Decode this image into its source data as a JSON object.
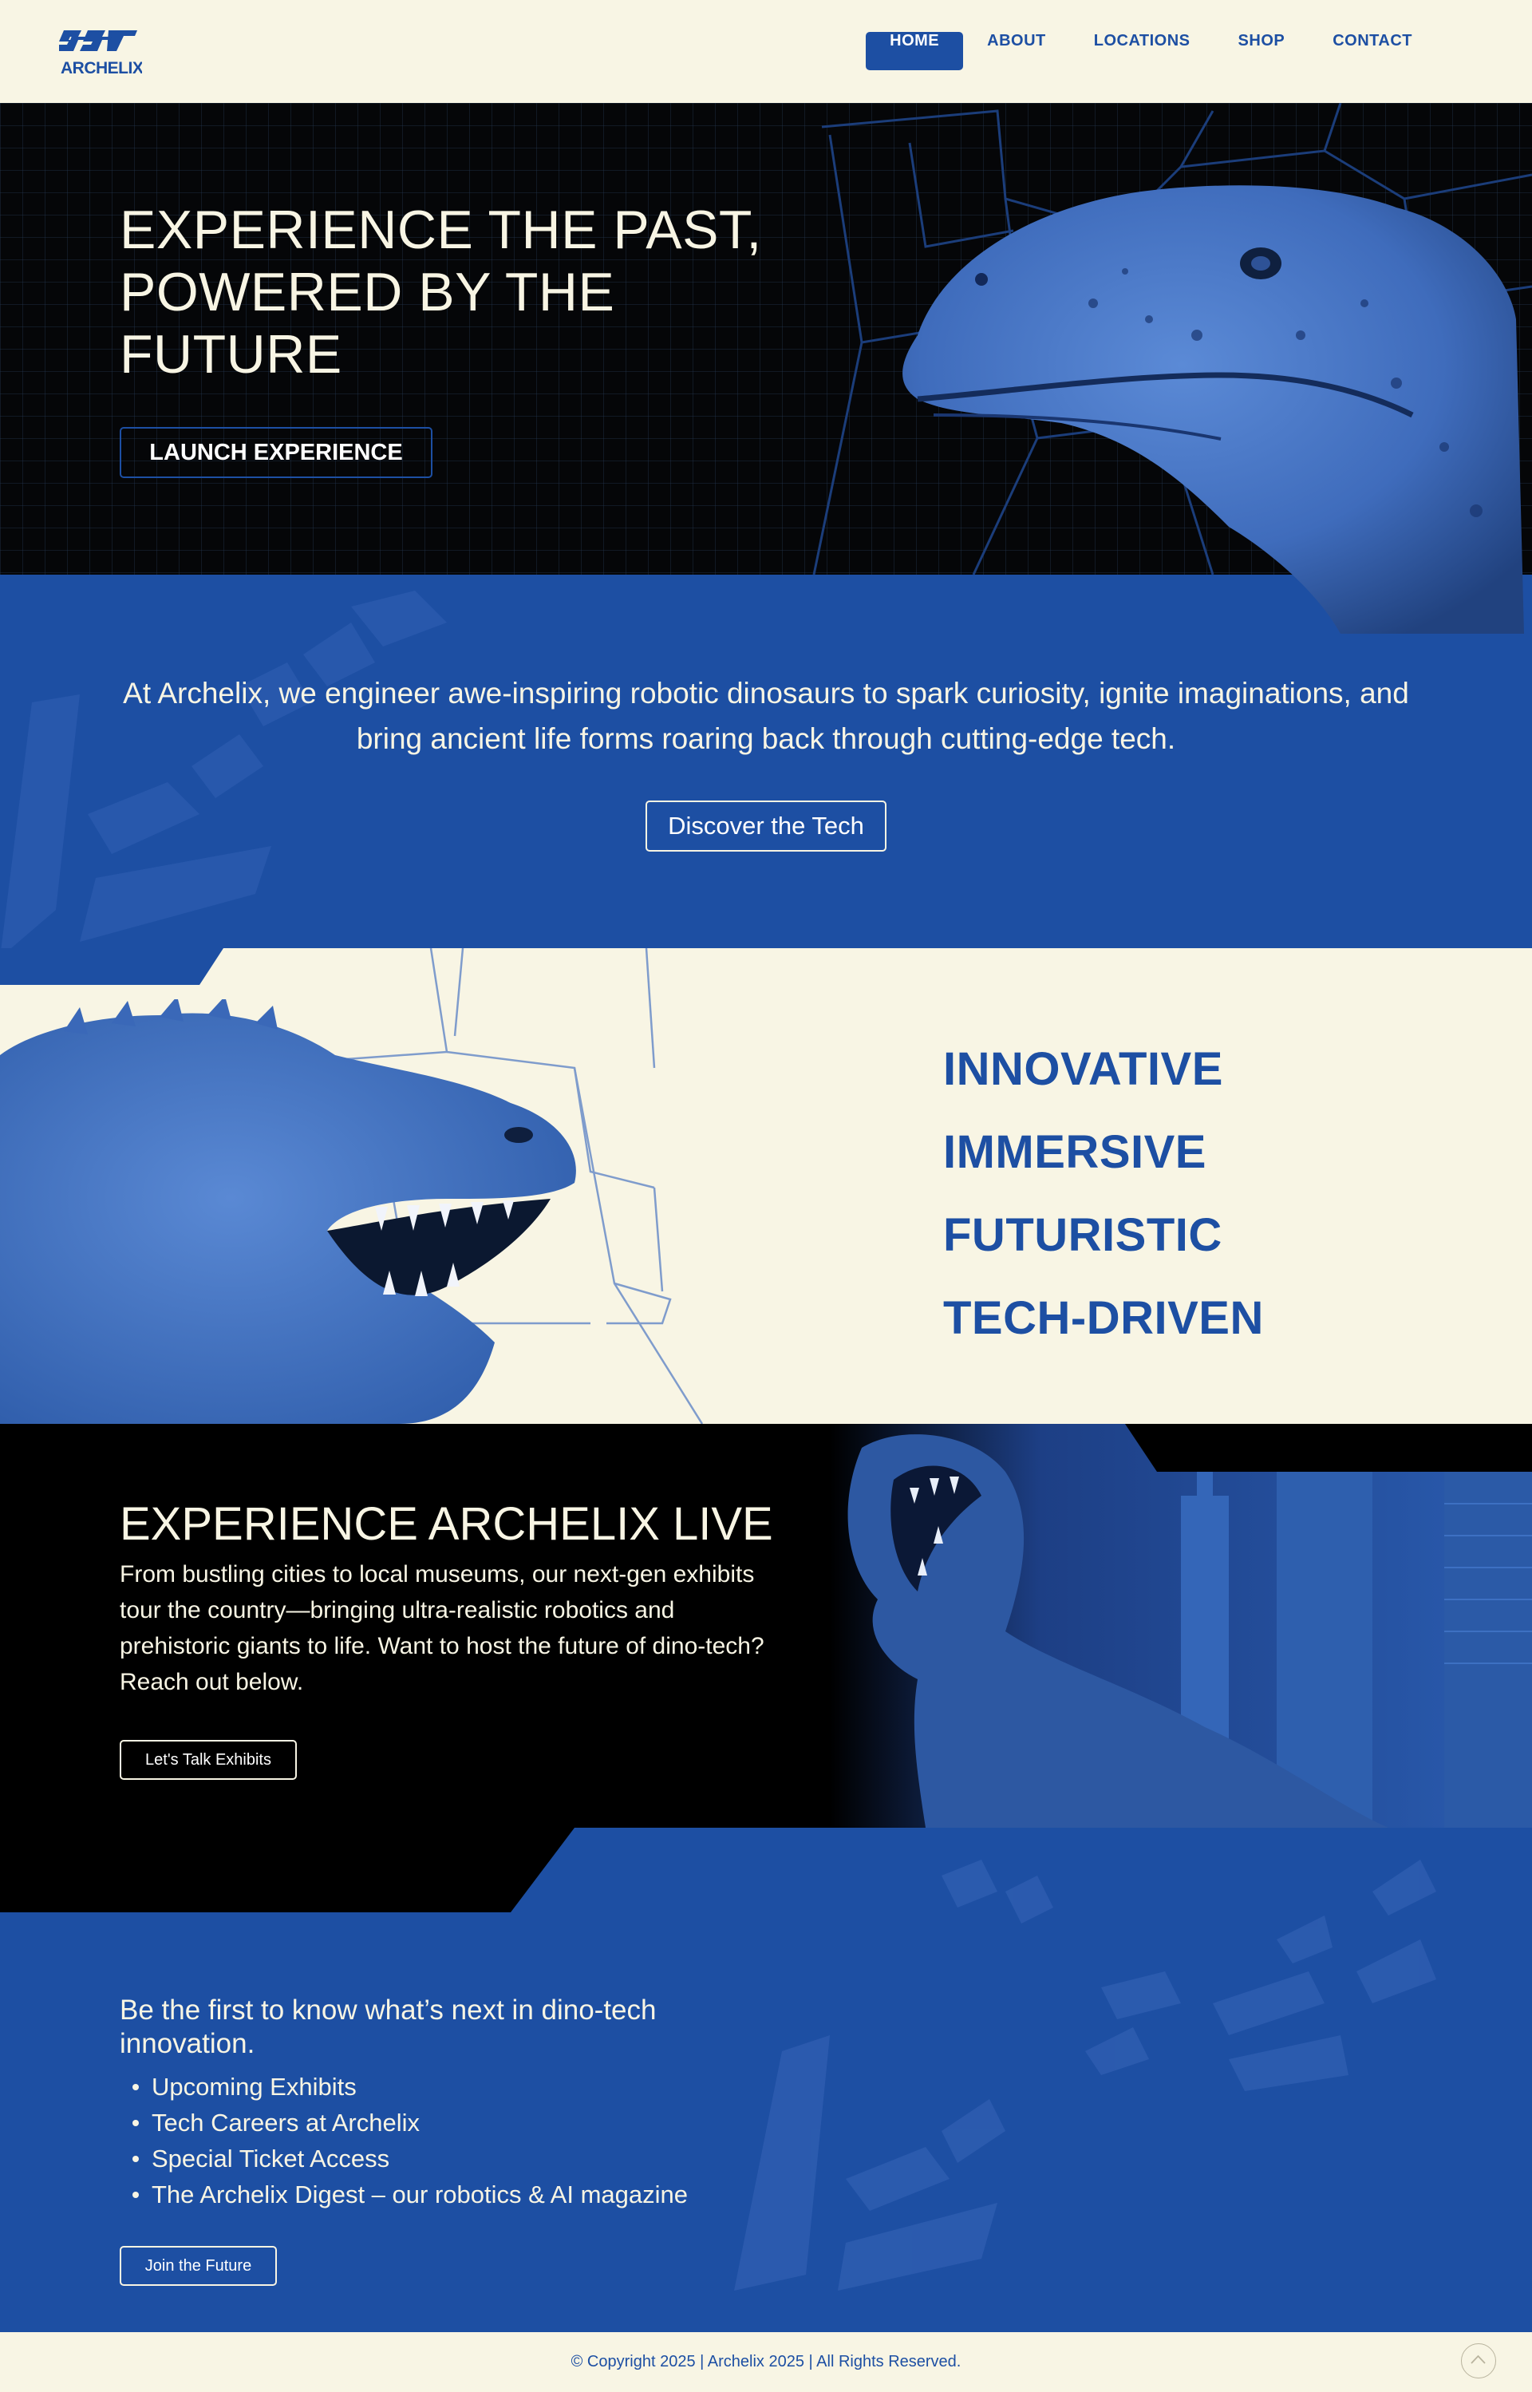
{
  "brand": {
    "logo_text": "ARCHELIX",
    "primary_color": "#1d4fa3",
    "cream_color": "#f8f5e4",
    "dark_color": "#000000"
  },
  "nav": {
    "items": [
      {
        "label": "HOME",
        "active": true
      },
      {
        "label": "ABOUT",
        "active": false
      },
      {
        "label": "LOCATIONS",
        "active": false
      },
      {
        "label": "SHOP",
        "active": false
      },
      {
        "label": "CONTACT",
        "active": false
      }
    ]
  },
  "hero": {
    "title_line1": "EXPERIENCE THE PAST,",
    "title_line2": "POWERED BY THE",
    "title_line3": "FUTURE",
    "button_label": "LAUNCH EXPERIENCE"
  },
  "mission": {
    "text": "At Archelix, we engineer awe-inspiring robotic dinosaurs to spark curiosity, ignite imaginations, and bring ancient life forms roaring back through cutting-edge tech.",
    "button_label": "Discover the Tech"
  },
  "features": {
    "items": [
      "INNOVATIVE",
      "IMMERSIVE",
      "FUTURISTIC",
      "TECH-DRIVEN"
    ]
  },
  "live": {
    "title": "EXPERIENCE ARCHELIX LIVE",
    "body": "From bustling cities to local museums, our next-gen exhibits tour the country—bringing ultra-realistic robotics and prehistoric giants to life. Want to host the future of dino-tech? Reach out below.",
    "button_label": "Let's Talk Exhibits"
  },
  "newsletter": {
    "title": "Be the first to know what’s next in dino-tech innovation.",
    "items": [
      "Upcoming Exhibits",
      "Tech Careers at Archelix",
      "Special Ticket Access",
      "The Archelix Digest – our robotics & AI magazine"
    ],
    "button_label": "Join the Future"
  },
  "footer": {
    "copyright": "© Copyright 2025  |  Archelix 2025  |  All Rights Reserved.",
    "back_to_top_icon": "chevron-up-icon"
  }
}
